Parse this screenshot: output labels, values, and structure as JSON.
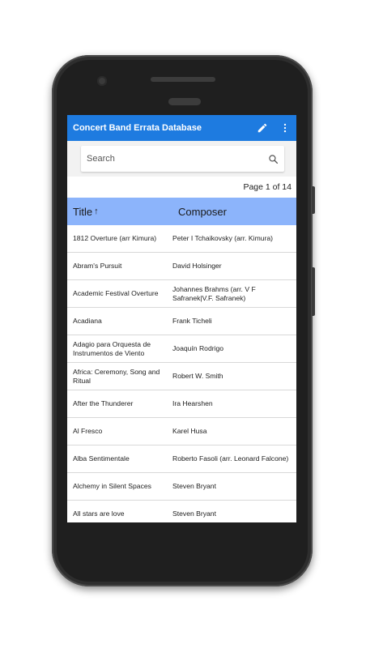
{
  "app": {
    "title": "Concert Band Errata Database",
    "edit_icon": "pencil-icon",
    "menu_icon": "more-vert-icon",
    "bar_color": "#1e7be0"
  },
  "search": {
    "placeholder": "Search",
    "value": "",
    "icon": "search-icon"
  },
  "pager": {
    "text": "Page 1 of 14"
  },
  "table": {
    "header_color": "#8cb4fb",
    "columns": {
      "title": "Title",
      "title_sort": "↑",
      "composer": "Composer"
    },
    "rows": [
      {
        "title": "1812 Overture (arr Kimura)",
        "composer": "Peter I Tchaikovsky (arr. Kimura)"
      },
      {
        "title": "Abram's Pursuit",
        "composer": "David Holsinger"
      },
      {
        "title": "Academic Festival Overture",
        "composer": "Johannes Brahms (arr. V F Safranek|V.F. Safranek)"
      },
      {
        "title": "Acadiana",
        "composer": "Frank Ticheli"
      },
      {
        "title": "Adagio para Orquesta de Instrumentos de Viento",
        "composer": "Joaquín Rodrigo"
      },
      {
        "title": "Africa: Ceremony, Song and Ritual",
        "composer": "Robert W. Smith"
      },
      {
        "title": "After the Thunderer",
        "composer": "Ira Hearshen"
      },
      {
        "title": "Al Fresco",
        "composer": "Karel Husa"
      },
      {
        "title": "Alba Sentimentale",
        "composer": "Roberto Fasoli (arr. Leonard Falcone)"
      },
      {
        "title": "Alchemy in Silent Spaces",
        "composer": "Steven Bryant"
      },
      {
        "title": "All stars are love",
        "composer": "Steven Bryant"
      }
    ]
  }
}
